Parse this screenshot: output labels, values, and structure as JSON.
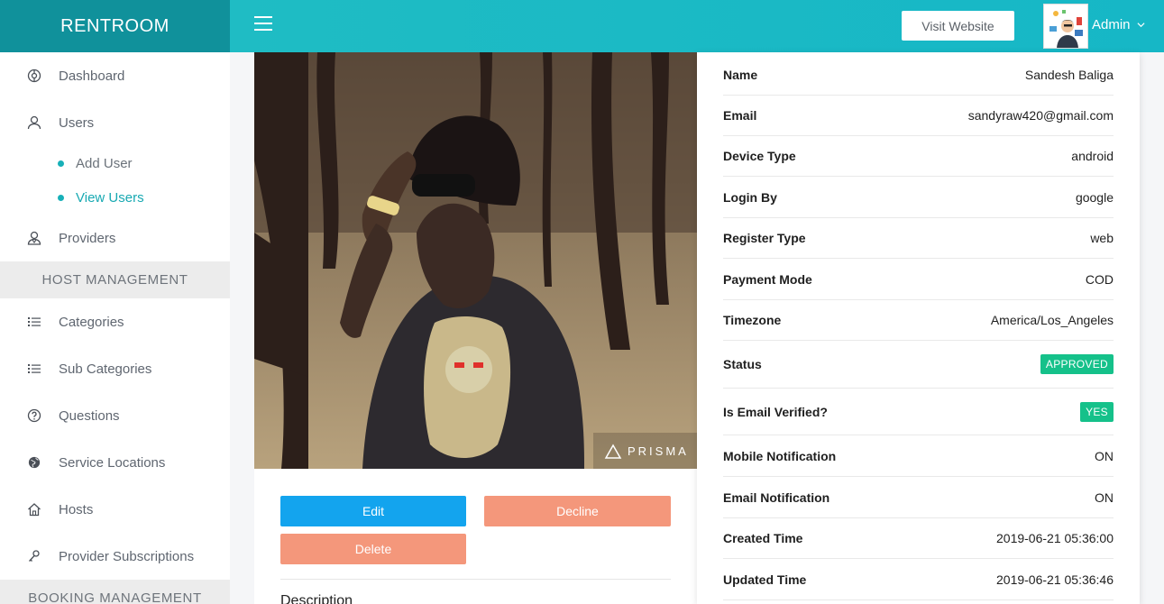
{
  "brand": "RENTROOM",
  "sidebar": {
    "items": [
      {
        "label": "Dashboard",
        "icon": "dashboard-icon"
      },
      {
        "label": "Users",
        "icon": "user-icon"
      },
      {
        "label": "Add User"
      },
      {
        "label": "View Users"
      },
      {
        "label": "Providers",
        "icon": "provider-icon"
      },
      {
        "label": "HOST MANAGEMENT"
      },
      {
        "label": "Categories",
        "icon": "list-icon"
      },
      {
        "label": "Sub Categories",
        "icon": "list-icon"
      },
      {
        "label": "Questions",
        "icon": "question-icon"
      },
      {
        "label": "Service Locations",
        "icon": "globe-icon"
      },
      {
        "label": "Hosts",
        "icon": "home-icon"
      },
      {
        "label": "Provider Subscriptions",
        "icon": "key-icon"
      },
      {
        "label": "BOOKING MANAGEMENT"
      }
    ]
  },
  "topbar": {
    "visit_label": "Visit Website",
    "admin_label": "Admin"
  },
  "photo": {
    "watermark": "PRISMA"
  },
  "actions": {
    "edit": "Edit",
    "decline": "Decline",
    "delete": "Delete",
    "description_label": "Description"
  },
  "details": [
    {
      "key": "Name",
      "value": "Sandesh Baliga"
    },
    {
      "key": "Email",
      "value": "sandyraw420@gmail.com"
    },
    {
      "key": "Device Type",
      "value": "android"
    },
    {
      "key": "Login By",
      "value": "google"
    },
    {
      "key": "Register Type",
      "value": "web"
    },
    {
      "key": "Payment Mode",
      "value": "COD"
    },
    {
      "key": "Timezone",
      "value": "America/Los_Angeles"
    },
    {
      "key": "Status",
      "value": "APPROVED"
    },
    {
      "key": "Is Email Verified?",
      "value": "YES"
    },
    {
      "key": "Mobile Notification",
      "value": "ON"
    },
    {
      "key": "Email Notification",
      "value": "ON"
    },
    {
      "key": "Created Time",
      "value": "2019-06-21 05:36:00"
    },
    {
      "key": "Updated Time",
      "value": "2019-06-21 05:36:46"
    }
  ],
  "colors": {
    "brand": "#10919b",
    "topbar": "#1fbcc4",
    "edit": "#13a4ee",
    "danger": "#f4977b",
    "success": "#15c18a"
  }
}
